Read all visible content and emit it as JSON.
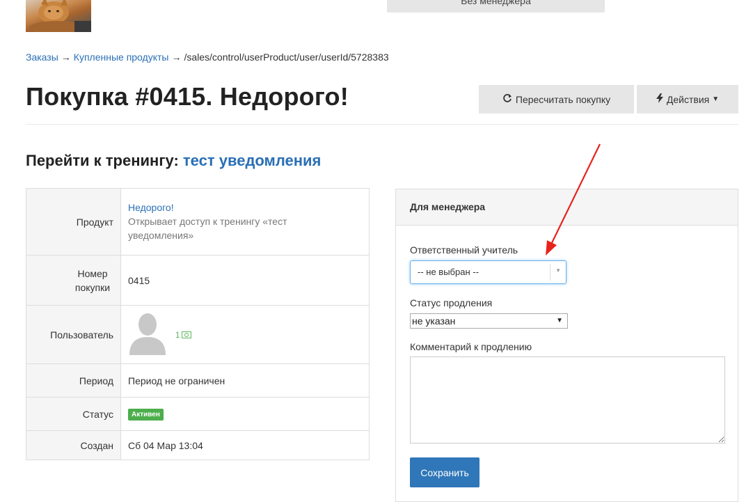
{
  "top_button": {
    "label": "Без менеджера"
  },
  "breadcrumb": {
    "items": [
      "Заказы",
      "Купленные продукты",
      "/sales/control/userProduct/user/userId/5728383"
    ],
    "separator": "→"
  },
  "page": {
    "title": "Покупка #0415. Недорого!"
  },
  "header_buttons": {
    "recalc": {
      "label": "Пересчитать покупку",
      "icon": "refresh-icon"
    },
    "actions": {
      "label": "Действия",
      "icon": "bolt-icon"
    }
  },
  "training": {
    "prefix": "Перейти к тренингу:",
    "link": "тест уведомления"
  },
  "info_table": {
    "product_label": "Продукт",
    "product_name": "Недорого!",
    "product_desc": "Открывает доступ к тренингу «тест уведомления»",
    "number_label": "Номер покупки",
    "number_value": "0415",
    "user_label": "Пользователь",
    "user_count": "1",
    "period_label": "Период",
    "period_value": "Период не ограничен",
    "status_label": "Статус",
    "status_value": "Активен",
    "created_label": "Создан",
    "created_value": "Сб 04 Мар 13:04"
  },
  "manager_panel": {
    "title": "Для менеджера",
    "teacher_label": "Ответственный учитель",
    "teacher_value": "-- не выбран --",
    "renewal_label": "Статус продления",
    "renewal_value": "не указан",
    "comment_label": "Комментарий к продлению",
    "comment_value": "",
    "save_label": "Сохранить"
  },
  "colors": {
    "link": "#2a6fb5",
    "primary_button": "#2f77b8",
    "status_active": "#4cae4c",
    "annotation_arrow": "#e8231b"
  }
}
